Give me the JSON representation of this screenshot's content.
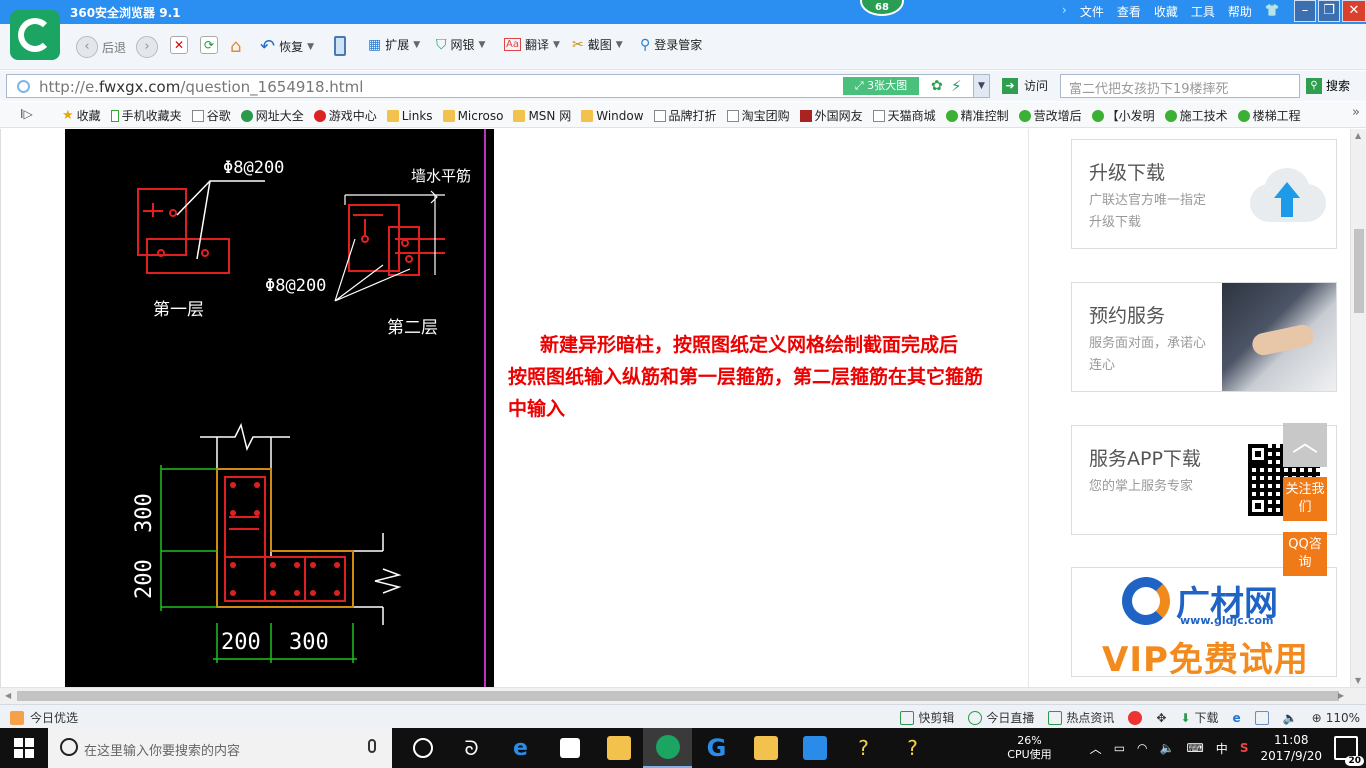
{
  "window": {
    "title": "360安全浏览器 9.1",
    "badge": "68",
    "menus": [
      "文件",
      "查看",
      "收藏",
      "工具",
      "帮助"
    ]
  },
  "toolbar": {
    "back": "后退",
    "restore": "恢复",
    "extend": "扩展",
    "bank": "网银",
    "translate": "翻译",
    "screenshot": "截图",
    "login": "登录管家"
  },
  "address": {
    "url_prefix": "http://e.",
    "url_domain": "fwxgx.com",
    "url_path": "/question_1654918.html",
    "big_image": "3张大图",
    "visit": "访问",
    "search_placeholder": "富二代把女孩扔下19楼摔死",
    "search": "搜索"
  },
  "bookmarks": [
    {
      "icon": "star",
      "label": "收藏"
    },
    {
      "icon": "phone",
      "label": "手机收藏夹"
    },
    {
      "icon": "page",
      "label": "谷歌"
    },
    {
      "icon": "grn",
      "label": "网址大全"
    },
    {
      "icon": "red",
      "label": "游戏中心"
    },
    {
      "icon": "folder",
      "label": "Links"
    },
    {
      "icon": "folder",
      "label": "Microso"
    },
    {
      "icon": "folder",
      "label": "MSN 网"
    },
    {
      "icon": "folder",
      "label": "Window"
    },
    {
      "icon": "page",
      "label": "品牌打折"
    },
    {
      "icon": "page",
      "label": "淘宝团购"
    },
    {
      "icon": "red2",
      "label": "外国网友"
    },
    {
      "icon": "page",
      "label": "天猫商城"
    },
    {
      "icon": "wechat",
      "label": "精准控制"
    },
    {
      "icon": "wechat",
      "label": "营改增后"
    },
    {
      "icon": "wechat",
      "label": "【小发明"
    },
    {
      "icon": "wechat",
      "label": "施工技术"
    },
    {
      "icon": "wechat",
      "label": "楼梯工程"
    }
  ],
  "cad": {
    "label_phi8_top": "Φ8@200",
    "label_wall_rebar": "墙水平筋",
    "label_phi8_mid": "Φ8@200",
    "label_layer1": "第一层",
    "label_layer2": "第二层",
    "dim_300": "300",
    "dim_200_v": "200",
    "dim_200_h": "200",
    "dim_300_h": "300"
  },
  "article": {
    "line1": "新建异形暗柱，按照图纸定义网格绘制截面完成后",
    "line2": "按照图纸输入纵筋和第一层箍筋，第二层箍筋在其它箍筋",
    "line3": "中输入"
  },
  "sidebar": {
    "upgrade_title": "升级下载",
    "upgrade_desc": "广联达官方唯一指定升级下载",
    "service_title": "预约服务",
    "service_desc": "服务面对面，承诺心连心",
    "app_title": "服务APP下载",
    "app_desc": "您的掌上服务专家",
    "brand_name": "广材网",
    "brand_url": "www.gldjc.com",
    "vip": "VIP免费试用",
    "follow": "关注我们",
    "qq": "QQ咨询"
  },
  "statusbar": {
    "today": "今日优选",
    "clip": "快剪辑",
    "live": "今日直播",
    "news": "热点资讯",
    "download": "下载",
    "zoom": "110%"
  },
  "taskbar": {
    "search_placeholder": "在这里输入你要搜索的内容",
    "cpu_percent": "26%",
    "cpu_label": "CPU使用",
    "ime": "中",
    "time": "11:08",
    "date": "2017/9/20",
    "notifications": "20"
  },
  "colors": {
    "titlebar": "#2a8ff0",
    "article_text": "#ee0000",
    "cad_bg": "#000000",
    "accent_orange": "#f07a18"
  }
}
